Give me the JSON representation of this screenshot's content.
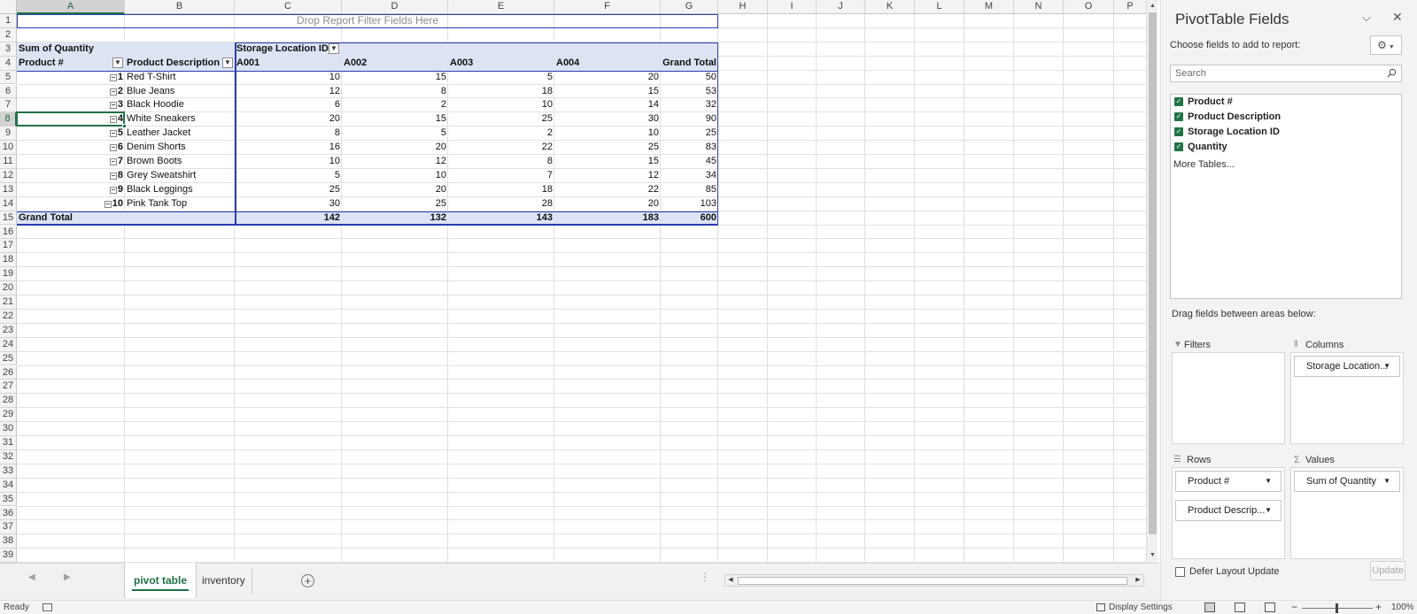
{
  "columns": [
    "A",
    "B",
    "C",
    "D",
    "E",
    "F",
    "G",
    "H",
    "I",
    "J",
    "K",
    "L",
    "M",
    "N",
    "O",
    "P"
  ],
  "active_column": "A",
  "active_row": 8,
  "rows": [
    "1",
    "2",
    "3",
    "4",
    "5",
    "6",
    "7",
    "8",
    "9",
    "10",
    "11",
    "12",
    "13",
    "14",
    "15",
    "16",
    "17",
    "18",
    "19",
    "20",
    "21",
    "22",
    "23",
    "24",
    "25",
    "26",
    "27",
    "28",
    "29",
    "30",
    "31",
    "32",
    "33",
    "34",
    "35",
    "36",
    "37",
    "38",
    "39"
  ],
  "drop_filter_text": "Drop Report Filter Fields Here",
  "pivot": {
    "value_header": "Sum of Quantity",
    "column_field": "Storage Location ID",
    "row_field_1": "Product #",
    "row_field_2": "Product Description",
    "column_items": [
      "A001",
      "A002",
      "A003",
      "A004",
      "Grand Total"
    ],
    "rows": [
      {
        "id": "1",
        "desc": "Red T-Shirt",
        "vals": [
          "10",
          "15",
          "5",
          "20",
          "50"
        ]
      },
      {
        "id": "2",
        "desc": "Blue Jeans",
        "vals": [
          "12",
          "8",
          "18",
          "15",
          "53"
        ]
      },
      {
        "id": "3",
        "desc": "Black Hoodie",
        "vals": [
          "6",
          "2",
          "10",
          "14",
          "32"
        ]
      },
      {
        "id": "4",
        "desc": "White Sneakers",
        "vals": [
          "20",
          "15",
          "25",
          "30",
          "90"
        ]
      },
      {
        "id": "5",
        "desc": "Leather Jacket",
        "vals": [
          "8",
          "5",
          "2",
          "10",
          "25"
        ]
      },
      {
        "id": "6",
        "desc": "Denim Shorts",
        "vals": [
          "16",
          "20",
          "22",
          "25",
          "83"
        ]
      },
      {
        "id": "7",
        "desc": "Brown Boots",
        "vals": [
          "10",
          "12",
          "8",
          "15",
          "45"
        ]
      },
      {
        "id": "8",
        "desc": "Grey Sweatshirt",
        "vals": [
          "5",
          "10",
          "7",
          "12",
          "34"
        ]
      },
      {
        "id": "9",
        "desc": "Black Leggings",
        "vals": [
          "25",
          "20",
          "18",
          "22",
          "85"
        ]
      },
      {
        "id": "10",
        "desc": "Pink Tank Top",
        "vals": [
          "30",
          "25",
          "28",
          "20",
          "103"
        ]
      }
    ],
    "grand_total_label": "Grand Total",
    "grand_total_vals": [
      "142",
      "132",
      "143",
      "183",
      "600"
    ]
  },
  "tabs": {
    "active": "pivot table",
    "other": "inventory",
    "add_icon": "plus-circle-icon"
  },
  "status": {
    "ready": "Ready",
    "display_settings": "Display Settings",
    "zoom": "100%",
    "zoom_minus": "−",
    "zoom_plus": "+"
  },
  "pane": {
    "title": "PivotTable Fields",
    "choose_fields": "Choose fields to add to report:",
    "search_placeholder": "Search",
    "fields": [
      "Product #",
      "Product Description",
      "Storage Location ID",
      "Quantity"
    ],
    "more_tables": "More Tables...",
    "drag_between": "Drag fields between areas below:",
    "filters_label": "Filters",
    "columns_label": "Columns",
    "rows_label": "Rows",
    "values_label": "Values",
    "columns_chip": "Storage Location...",
    "rows_chip_1": "Product #",
    "rows_chip_2": "Product Descrip...",
    "values_chip": "Sum of Quantity",
    "defer_label": "Defer Layout Update",
    "update_label": "Update"
  }
}
